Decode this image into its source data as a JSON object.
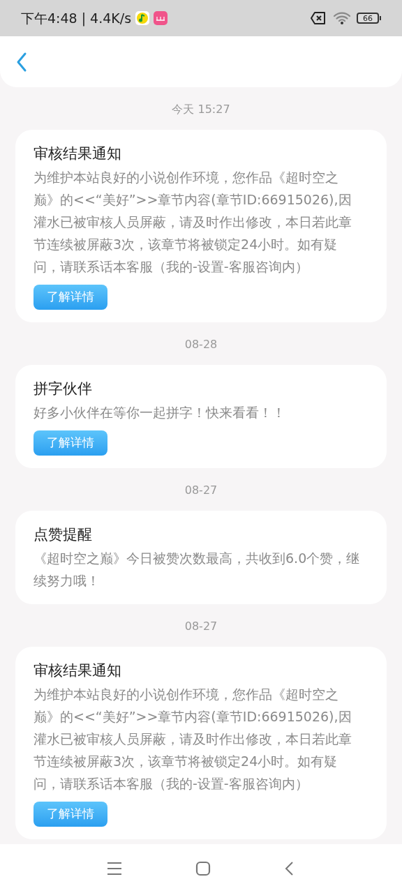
{
  "status_bar": {
    "time": "下午4:48",
    "separator": "|",
    "speed": "4.4K/s",
    "battery": "66"
  },
  "messages": [
    {
      "date": "今天 15:27",
      "title": "审核结果通知",
      "body": "为维护本站良好的小说创作环境，您作品《超时空之巅》的<<“美好”>>章节内容(章节ID:66915026),因灌水已被审核人员屏蔽，请及时作出修改，本日若此章节连续被屏蔽3次，该章节将被锁定24小时。如有疑问，请联系话本客服（我的-设置-客服咨询内）",
      "action": "了解详情"
    },
    {
      "date": "08-28",
      "title": "拼字伙伴",
      "body": "好多小伙伴在等你一起拼字！快来看看！！",
      "action": "了解详情"
    },
    {
      "date": "08-27",
      "title": "点赞提醒",
      "body": "《超时空之巅》今日被赞次数最高，共收到6.0个赞，继续努力哦！"
    },
    {
      "date": "08-27",
      "title": "审核结果通知",
      "body": "为维护本站良好的小说创作环境，您作品《超时空之巅》的<<“美好”>>章节内容(章节ID:66915026),因灌水已被审核人员屏蔽，请及时作出修改，本日若此章节连续被屏蔽3次，该章节将被锁定24小时。如有疑问，请联系话本客服（我的-设置-客服咨询内）",
      "action": "了解详情"
    }
  ]
}
